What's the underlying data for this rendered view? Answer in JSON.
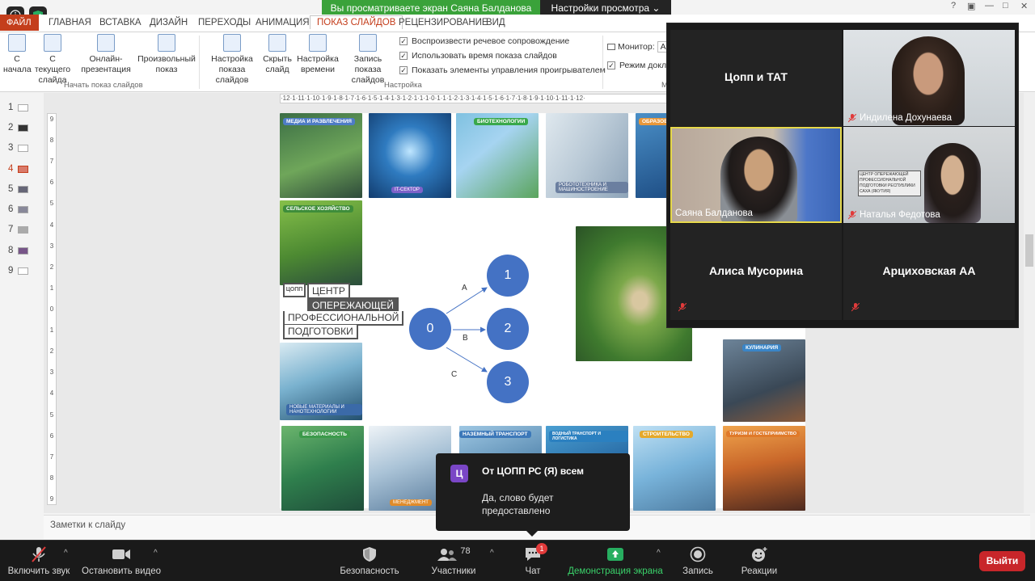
{
  "share_banner": {
    "message": "Вы просматриваете экран Саяна Балданова",
    "view_options": "Настройки просмотра"
  },
  "window_controls": {
    "help": "?",
    "restore": "▣",
    "minimize": "—",
    "maximize": "□",
    "close": "✕"
  },
  "ribbon": {
    "file_tab": "ФАЙЛ",
    "tabs": [
      "ГЛАВНАЯ",
      "ВСТАВКА",
      "ДИЗАЙН",
      "ПЕРЕХОДЫ",
      "АНИМАЦИЯ",
      "ПОКАЗ СЛАЙДОВ",
      "РЕЦЕНЗИРОВАНИЕ",
      "ВИД"
    ],
    "active_tab": "ПОКАЗ СЛАЙДОВ",
    "buttons": {
      "from_start": "С\nначала",
      "from_current": "С текущего\nслайда",
      "online": "Онлайн-\nпрезентация",
      "custom": "Произвольный\nпоказ",
      "setup": "Настройка\nпоказа слайдов",
      "hide": "Скрыть\nслайд",
      "rehearse": "Настройка\nвремени",
      "record": "Запись показа\nслайдов"
    },
    "groups": {
      "start": "Начать показ слайдов",
      "setup": "Настройка",
      "monitors": "М"
    },
    "checks": {
      "narration": "Воспроизвести речевое сопровождение",
      "timings": "Использовать время показа слайдов",
      "media_controls": "Показать элементы управления проигрывателем"
    },
    "monitor_label": "Монитор:",
    "monitor_value": "Ав",
    "presenter_view": "Режим докла"
  },
  "slides": {
    "numbers": [
      "1",
      "2",
      "3",
      "4",
      "5",
      "6",
      "7",
      "8",
      "9"
    ],
    "current": "4"
  },
  "ruler": {
    "top": "·12·1·11·1·10·1·9·1·8·1·7·1·6·1·5·1·4·1·3·1·2·1·1·1·0·1·1·1·2·1·3·1·4·1·5·1·6·1·7·1·8·1·9·1·10·1·11·1·12·",
    "left": [
      "9",
      "8",
      "7",
      "6",
      "5",
      "4",
      "3",
      "2",
      "1",
      "0",
      "1",
      "2",
      "3",
      "4",
      "5",
      "6",
      "7",
      "8",
      "9"
    ]
  },
  "slide": {
    "tiles": {
      "media": "Медиа и развлечения",
      "it": "IT-сектор",
      "bio": "Биотехнологии",
      "robo": "Робототехника и машиностроение",
      "edu": "Образова",
      "agro": "Сельское хозяйство",
      "materials": "Новые материалы и нанотехнологии",
      "safety": "Безопасность",
      "management": "Менеджмент",
      "transport": "Наземный транспорт",
      "water": "Водный транспорт и логистика",
      "construction": "Строительство",
      "tourism": "Туризм и гостеприимство",
      "cooking": "Кулинария"
    },
    "logo": {
      "mark": "ЦОПП",
      "line1": "ЦЕНТР",
      "line2": "ОПЕРЕЖАЮЩЕЙ",
      "line3": "ПРОФЕССИОНАЛЬНОЙ",
      "line4": "ПОДГОТОВКИ"
    },
    "graph": {
      "nodes": [
        "0",
        "1",
        "2",
        "3"
      ],
      "edges": [
        "A",
        "B",
        "C"
      ]
    }
  },
  "notes_placeholder": "Заметки к слайду",
  "video": {
    "tiles": [
      {
        "name": "Цопп и ТАТ"
      },
      {
        "name": "Индилена Дохунаева"
      },
      {
        "name": "Саяна Балданова"
      },
      {
        "name": "Наталья Федотова"
      },
      {
        "name": "Алиса Мусорина"
      },
      {
        "name": "Арциховская АА"
      }
    ],
    "room_sign": "ЦЕНТР ОПЕРЕЖАЮЩЕЙ ПРОФЕССИОНАЛЬНОЙ ПОДГОТОВКИ РЕСПУБЛИКИ САХА (ЯКУТИЯ)"
  },
  "chat_popup": {
    "avatar": "Ц",
    "from": "От ЦОПП РС (Я) всем",
    "message": "Да, слово будет предоставлено"
  },
  "toolbar": {
    "unmute": "Включить звук",
    "stop_video": "Остановить видео",
    "security": "Безопасность",
    "participants": "Участники",
    "participants_count": "78",
    "chat": "Чат",
    "chat_badge": "1",
    "share": "Демонстрация экрана",
    "record": "Запись",
    "reactions": "Реакции",
    "leave": "Выйти"
  },
  "colors": {
    "accent_ppt": "#c43e1c",
    "zoom_green": "#3aa23a",
    "node_blue": "#4472c4",
    "leave_red": "#c8262a",
    "active_speaker": "#e6d84a"
  }
}
